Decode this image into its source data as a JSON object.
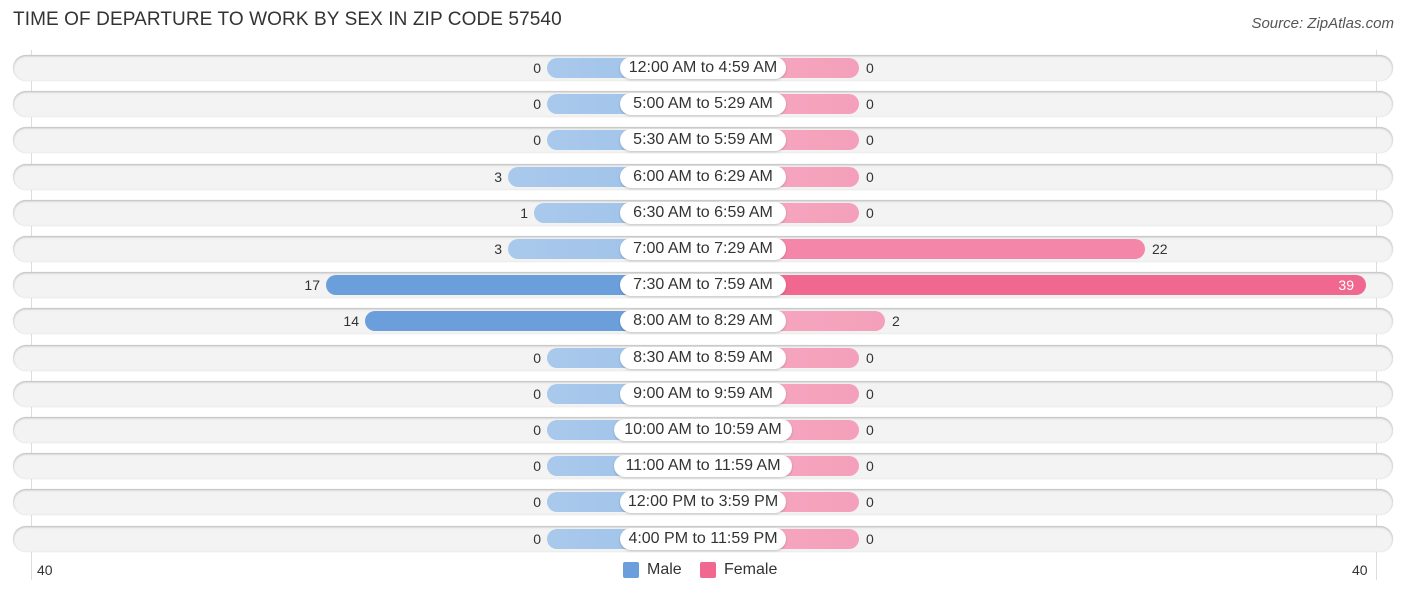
{
  "chart_data": {
    "type": "bar",
    "orientation": "horizontal-diverging",
    "title": "TIME OF DEPARTURE TO WORK BY SEX IN ZIP CODE 57540",
    "source": "Source: ZipAtlas.com",
    "categories": [
      "12:00 AM to 4:59 AM",
      "5:00 AM to 5:29 AM",
      "5:30 AM to 5:59 AM",
      "6:00 AM to 6:29 AM",
      "6:30 AM to 6:59 AM",
      "7:00 AM to 7:29 AM",
      "7:30 AM to 7:59 AM",
      "8:00 AM to 8:29 AM",
      "8:30 AM to 8:59 AM",
      "9:00 AM to 9:59 AM",
      "10:00 AM to 10:59 AM",
      "11:00 AM to 11:59 AM",
      "12:00 PM to 3:59 PM",
      "4:00 PM to 11:59 PM"
    ],
    "series": [
      {
        "name": "Male",
        "color": "#6a9fdc",
        "values": [
          0,
          0,
          0,
          3,
          1,
          3,
          17,
          14,
          0,
          0,
          0,
          0,
          0,
          0
        ]
      },
      {
        "name": "Female",
        "color": "#f06890",
        "values": [
          0,
          0,
          0,
          0,
          0,
          22,
          39,
          2,
          0,
          0,
          0,
          0,
          0,
          0
        ]
      }
    ],
    "axis": {
      "left_tick": "40",
      "right_tick": "40",
      "range": [
        -40,
        40
      ]
    },
    "legend": {
      "position": "bottom-center",
      "items": [
        "Male",
        "Female"
      ]
    },
    "grid": false
  }
}
